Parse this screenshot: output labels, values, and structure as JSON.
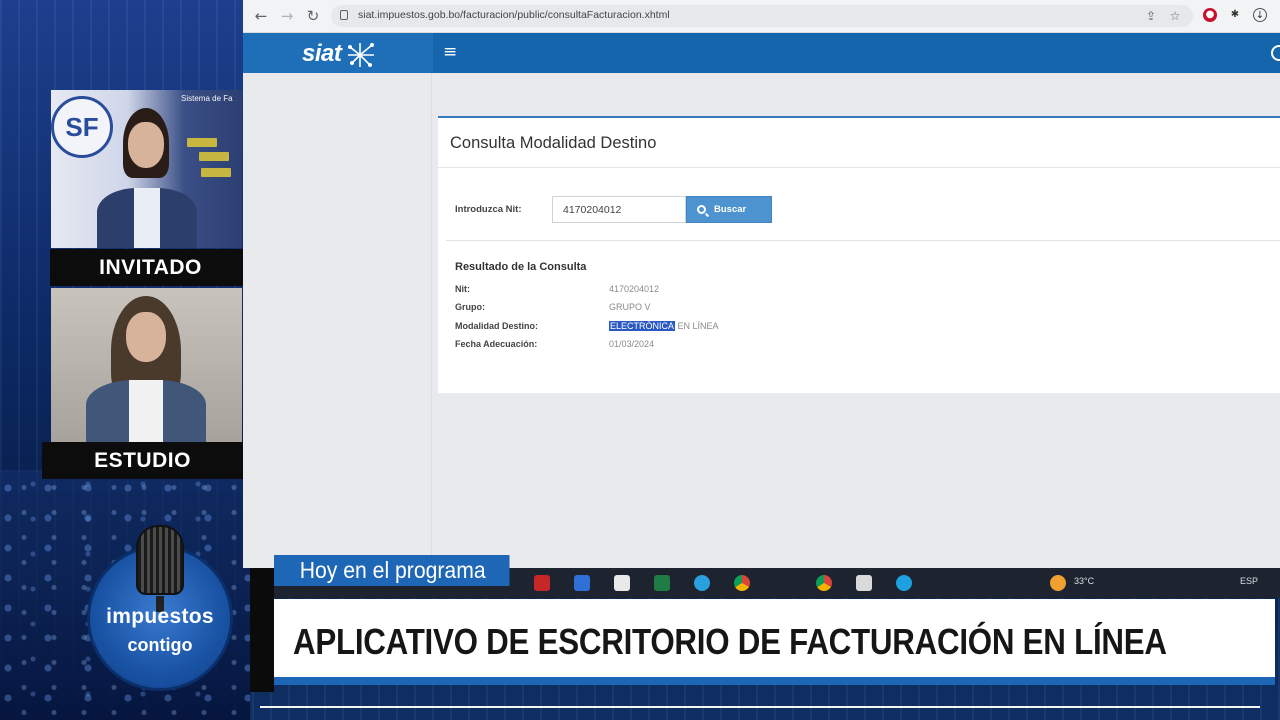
{
  "browser": {
    "url": "siat.impuestos.gob.bo/facturacion/public/consultaFacturacion.xhtml"
  },
  "siat": {
    "logo_text": "siat",
    "menu_glyph": "≡"
  },
  "panel": {
    "title": "Consulta Modalidad Destino",
    "nit_label": "Introduzca Nit:",
    "nit_value": "4170204012",
    "search_button": "Buscar",
    "result_title": "Resultado de la Consulta",
    "rows": [
      {
        "label": "Nit:",
        "value": "4170204012"
      },
      {
        "label": "Grupo:",
        "value": "GRUPO V"
      },
      {
        "label": "Modalidad Destino:",
        "value_selected": "ELECTRÓNICA",
        "value_rest": " EN LÍNEA"
      },
      {
        "label": "Fecha Adecuación:",
        "value": "01/03/2024"
      }
    ]
  },
  "broadcast": {
    "guest_label": "INVITADO",
    "studio_label": "ESTUDIO",
    "program_tab": "Hoy en el programa",
    "headline": "APLICATIVO DE ESCRITORIO DE FACTURACIÓN EN LÍNEA",
    "show_logo_line1": "impuestos",
    "show_logo_line2": "contigo",
    "backdrop_logo": "SF",
    "backdrop_caption": "Sistema de Fa"
  },
  "taskbar": {
    "temperature": "33°C",
    "language": "ESP"
  },
  "colors": {
    "siat_blue": "#1565ad",
    "button_blue": "#4d93cf",
    "broadcast_blue": "#1e66b6",
    "selection": "#2b59c3"
  }
}
